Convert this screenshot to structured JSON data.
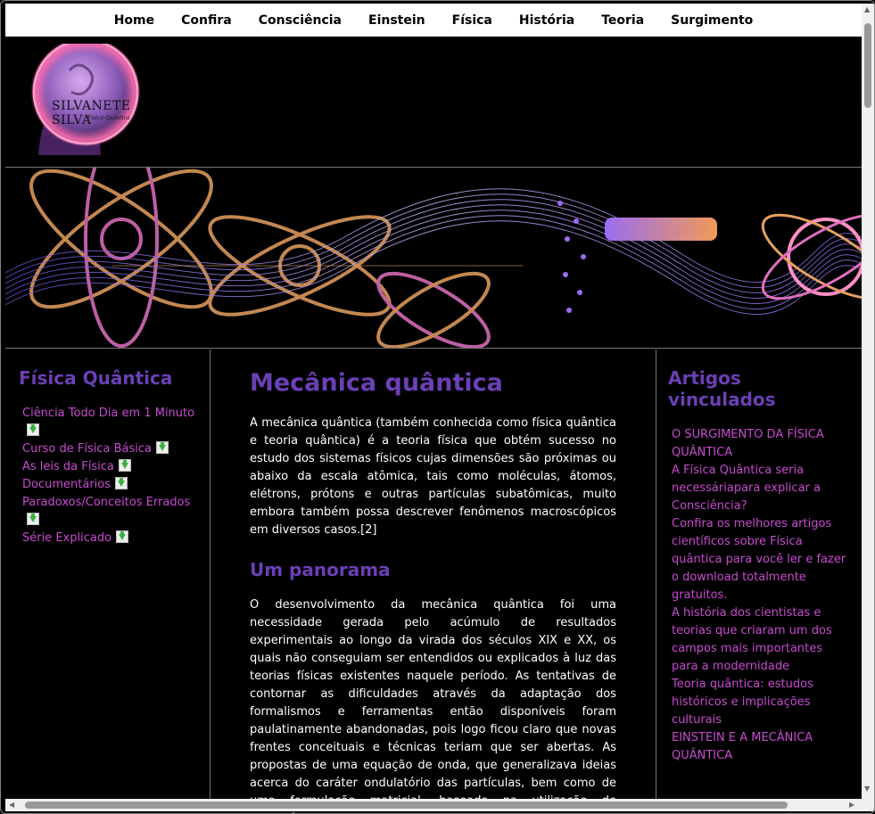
{
  "nav": {
    "items": [
      "Home",
      "Confira",
      "Consciência",
      "Einstein",
      "Física",
      "História",
      "Teoria",
      "Surgimento"
    ]
  },
  "logo": {
    "name": "SILVANETE SILVA",
    "subtitle": "Física Quântica",
    "glow_color": "#ff6fb0"
  },
  "left": {
    "heading": "Física Quântica",
    "links": [
      "Ciência Todo Dia em 1 Minuto",
      "Curso de Física Básica",
      "As leis da Física",
      "Documentários",
      "Paradoxos/Conceitos Errados",
      "Série Explicado"
    ],
    "icon": "download-icon"
  },
  "article": {
    "title": "Mecânica quântica",
    "intro": "A mecânica quântica (também conhecida como física quântica e teoria quântica) é a teoria física que obtém sucesso no estudo dos sistemas físicos cujas dimensões são próximas ou abaixo da escala atômica, tais como moléculas, átomos, elétrons, prótons e outras partículas subatômicas, muito embora também possa descrever fenômenos macroscópicos em diversos casos.[2]",
    "section_title": "Um panorama",
    "section_text": "O desenvolvimento da mecânica quântica foi uma necessidade gerada pelo acúmulo de resultados experimentais ao longo da virada dos séculos XIX e XX, os quais não conseguiam ser entendidos ou explicados à luz das teorias físicas existentes naquele período. As tentativas de contornar as dificuldades através da adaptação dos formalismos e ferramentas então disponíveis foram paulatinamente abandonadas, pois logo ficou claro que novas frentes conceituais e técnicas teriam que ser abertas. As propostas de uma equação de onda, que generalizava ideias acerca do caráter ondulatório das partículas, bem como de uma formulação matricial, baseada na utilização de observáveis experimentais na descrição dos sistemas"
  },
  "right": {
    "heading": "Artigos vinculados",
    "links": [
      "O SURGIMENTO DA FÍSICA QUÂNTICA",
      "A Física Quântica seria necessáriapara explicar a Consciência?",
      "Confira os melhores artigos científicos sobre Física quântica para você ler e fazer o download totalmente gratuitos.",
      "A história dos cientistas e teorias que criaram um dos campos mais importantes para a modernidade",
      "Teoria quântica: estudos históricos e implicações culturais",
      "EINSTEIN E A MECÂNICA QUÂNTICA"
    ]
  },
  "colors": {
    "heading": "#6b3fb5",
    "link": "#c84ad0",
    "background": "#000000"
  }
}
